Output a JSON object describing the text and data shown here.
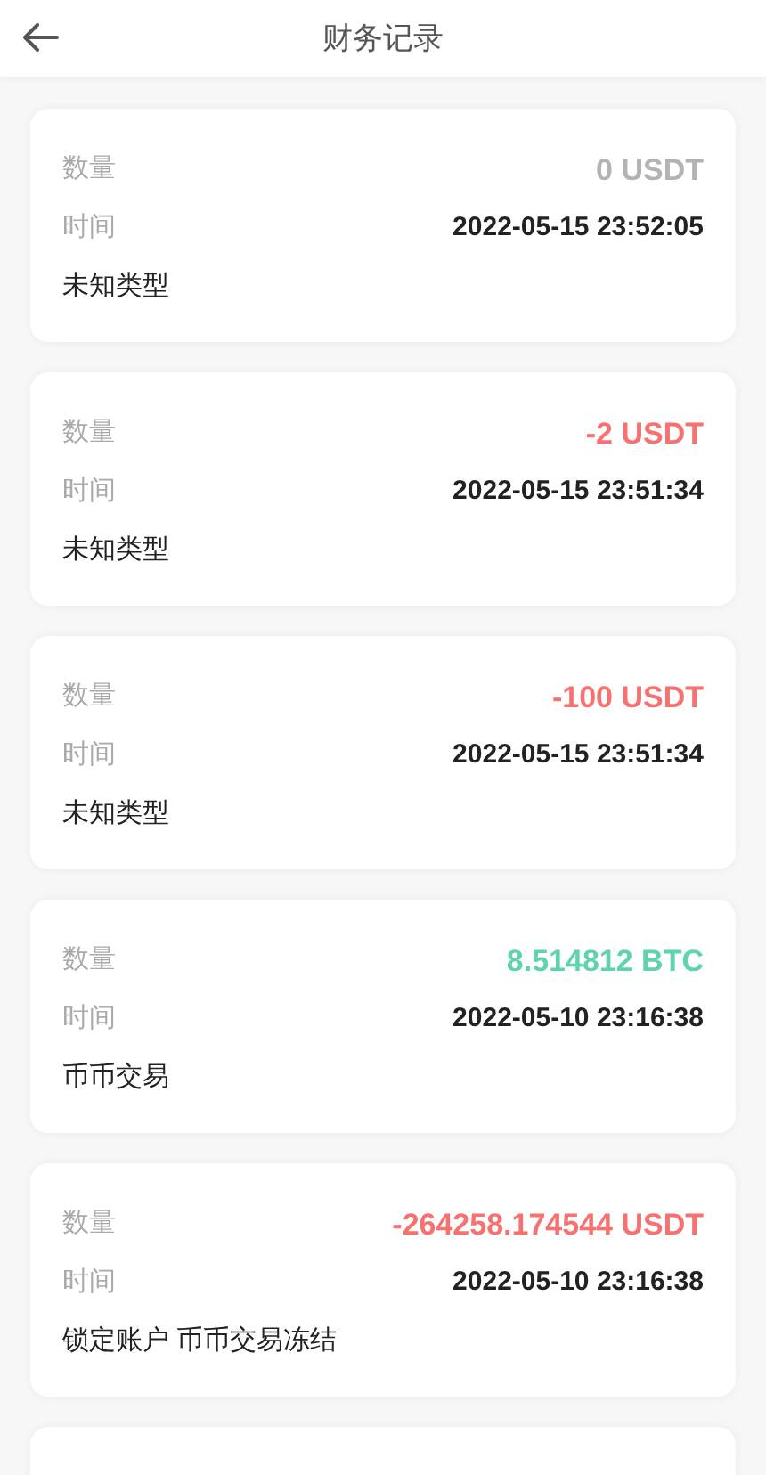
{
  "header": {
    "title": "财务记录"
  },
  "records": [
    {
      "amount_label": "数量",
      "amount": "0 USDT",
      "color": "#b3b3b3",
      "time_label": "时间",
      "time": "2022-05-15 23:52:05",
      "type": "未知类型"
    },
    {
      "amount_label": "数量",
      "amount": "-2 USDT",
      "color": "#f87171",
      "time_label": "时间",
      "time": "2022-05-15 23:51:34",
      "type": "未知类型"
    },
    {
      "amount_label": "数量",
      "amount": "-100 USDT",
      "color": "#f87171",
      "time_label": "时间",
      "time": "2022-05-15 23:51:34",
      "type": "未知类型"
    },
    {
      "amount_label": "数量",
      "amount": "8.514812 BTC",
      "color": "#5fd3b0",
      "time_label": "时间",
      "time": "2022-05-10 23:16:38",
      "type": "币币交易"
    },
    {
      "amount_label": "数量",
      "amount": "-264258.174544 USDT",
      "color": "#f87171",
      "time_label": "时间",
      "time": "2022-05-10 23:16:38",
      "type": "锁定账户 币币交易冻结"
    }
  ]
}
